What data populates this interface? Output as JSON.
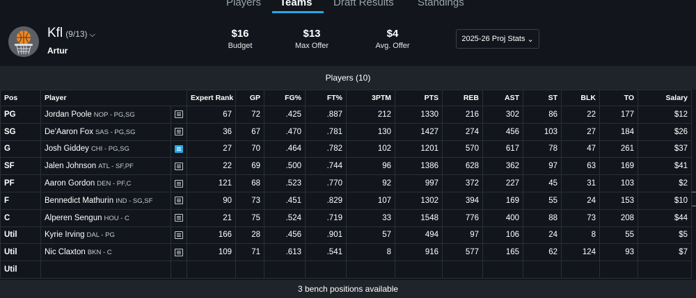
{
  "tabs": [
    {
      "label": "Players",
      "active": false
    },
    {
      "label": "Teams",
      "active": true
    },
    {
      "label": "Draft Results",
      "active": false
    },
    {
      "label": "Standings",
      "active": false
    }
  ],
  "team": {
    "name": "Kfl",
    "record": "(9/13)",
    "owner": "Artur",
    "avatar_icon": "basketball-hoop-icon"
  },
  "stats": [
    {
      "value": "$16",
      "label": "Budget"
    },
    {
      "value": "$13",
      "label": "Max Offer"
    },
    {
      "value": "$4",
      "label": "Avg. Offer"
    }
  ],
  "proj_select": "2025-26 Proj Stats",
  "players_header": "Players (10)",
  "columns": [
    "Pos",
    "Player",
    "Expert Rank",
    "GP",
    "FG%",
    "FT%",
    "3PTM",
    "PTS",
    "REB",
    "AST",
    "ST",
    "BLK",
    "TO",
    "Salary"
  ],
  "rows": [
    {
      "pos": "PG",
      "name": "Jordan Poole",
      "meta": "NOP - PG,SG",
      "note_active": false,
      "rank": "67",
      "gp": "72",
      "fg": ".425",
      "ft": ".887",
      "tpm": "212",
      "pts": "1330",
      "reb": "216",
      "ast": "302",
      "st": "86",
      "blk": "22",
      "to": "177",
      "salary": "$12"
    },
    {
      "pos": "SG",
      "name": "De'Aaron Fox",
      "meta": "SAS - PG,SG",
      "note_active": false,
      "rank": "36",
      "gp": "67",
      "fg": ".470",
      "ft": ".781",
      "tpm": "130",
      "pts": "1427",
      "reb": "274",
      "ast": "456",
      "st": "103",
      "blk": "27",
      "to": "184",
      "salary": "$26"
    },
    {
      "pos": "G",
      "name": "Josh Giddey",
      "meta": "CHI - PG,SG",
      "note_active": true,
      "rank": "27",
      "gp": "70",
      "fg": ".464",
      "ft": ".782",
      "tpm": "102",
      "pts": "1201",
      "reb": "570",
      "ast": "617",
      "st": "78",
      "blk": "47",
      "to": "261",
      "salary": "$37"
    },
    {
      "pos": "SF",
      "name": "Jalen Johnson",
      "meta": "ATL - SF,PF",
      "note_active": false,
      "rank": "22",
      "gp": "69",
      "fg": ".500",
      "ft": ".744",
      "tpm": "96",
      "pts": "1386",
      "reb": "628",
      "ast": "362",
      "st": "97",
      "blk": "63",
      "to": "169",
      "salary": "$41"
    },
    {
      "pos": "PF",
      "name": "Aaron Gordon",
      "meta": "DEN - PF,C",
      "note_active": false,
      "rank": "121",
      "gp": "68",
      "fg": ".523",
      "ft": ".770",
      "tpm": "92",
      "pts": "997",
      "reb": "372",
      "ast": "227",
      "st": "45",
      "blk": "31",
      "to": "103",
      "salary": "$2"
    },
    {
      "pos": "F",
      "name": "Bennedict Mathurin",
      "meta": "IND - SG,SF",
      "note_active": false,
      "rank": "90",
      "gp": "73",
      "fg": ".451",
      "ft": ".829",
      "tpm": "107",
      "pts": "1302",
      "reb": "394",
      "ast": "169",
      "st": "55",
      "blk": "24",
      "to": "153",
      "salary": "$10"
    },
    {
      "pos": "C",
      "name": "Alperen Sengun",
      "meta": "HOU - C",
      "note_active": false,
      "rank": "21",
      "gp": "75",
      "fg": ".524",
      "ft": ".719",
      "tpm": "33",
      "pts": "1548",
      "reb": "776",
      "ast": "400",
      "st": "88",
      "blk": "73",
      "to": "208",
      "salary": "$44"
    },
    {
      "pos": "Util",
      "name": "Kyrie Irving",
      "meta": "DAL - PG",
      "note_active": false,
      "rank": "166",
      "gp": "28",
      "fg": ".456",
      "ft": ".901",
      "tpm": "57",
      "pts": "494",
      "reb": "97",
      "ast": "106",
      "st": "24",
      "blk": "8",
      "to": "55",
      "salary": "$5"
    },
    {
      "pos": "Util",
      "name": "Nic Claxton",
      "meta": "BKN - C",
      "note_active": false,
      "rank": "109",
      "gp": "71",
      "fg": ".613",
      "ft": ".541",
      "tpm": "8",
      "pts": "916",
      "reb": "577",
      "ast": "165",
      "st": "62",
      "blk": "124",
      "to": "93",
      "salary": "$7"
    },
    {
      "pos": "Util",
      "name": "",
      "meta": "",
      "note_active": null,
      "rank": "",
      "gp": "",
      "fg": "",
      "ft": "",
      "tpm": "",
      "pts": "",
      "reb": "",
      "ast": "",
      "st": "",
      "blk": "",
      "to": "",
      "salary": ""
    }
  ],
  "bench_text": "3 bench positions available",
  "colors": {
    "accent": "#2aa7ea",
    "bg": "#12161c",
    "panel": "#1f242b"
  }
}
